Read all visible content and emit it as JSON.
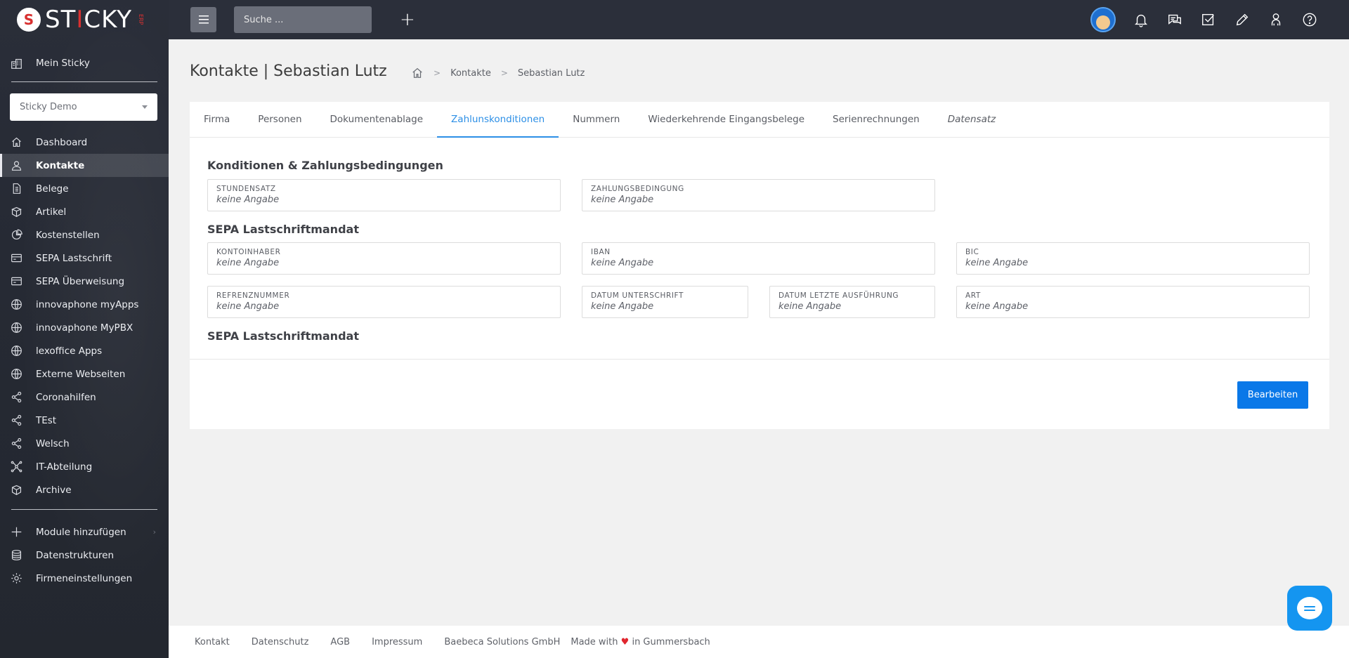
{
  "brand": {
    "name_pre": "ST",
    "name_i": "I",
    "name_post": "CKY",
    "tag": "ERP"
  },
  "sidebar": {
    "top_item": {
      "label": "Mein Sticky",
      "icon": "building-icon"
    },
    "workspace_select": {
      "value": "Sticky Demo"
    },
    "nav": [
      {
        "label": "Dashboard",
        "icon": "home-icon",
        "active": false
      },
      {
        "label": "Kontakte",
        "icon": "contacts-icon",
        "active": true
      },
      {
        "label": "Belege",
        "icon": "document-icon",
        "active": false
      },
      {
        "label": "Artikel",
        "icon": "box-icon",
        "active": false
      },
      {
        "label": "Kostenstellen",
        "icon": "pie-chart-icon",
        "active": false
      },
      {
        "label": "SEPA Lastschrift",
        "icon": "sepa-card-icon",
        "active": false
      },
      {
        "label": "SEPA Überweisung",
        "icon": "sepa-card-icon",
        "active": false
      },
      {
        "label": "innovaphone myApps",
        "icon": "globe-icon",
        "active": false
      },
      {
        "label": "innovaphone MyPBX",
        "icon": "globe-icon",
        "active": false
      },
      {
        "label": "lexoffice Apps",
        "icon": "globe-icon",
        "active": false
      },
      {
        "label": "Externe Webseiten",
        "icon": "globe-icon",
        "active": false
      },
      {
        "label": "Coronahilfen",
        "icon": "share-icon",
        "active": false
      },
      {
        "label": "TEst",
        "icon": "share-icon",
        "active": false
      },
      {
        "label": "Welsch",
        "icon": "share-icon",
        "active": false
      },
      {
        "label": "IT-Abteilung",
        "icon": "network-icon",
        "active": false
      },
      {
        "label": "Archive",
        "icon": "archive-box-icon",
        "active": false
      }
    ],
    "bottom": [
      {
        "label": "Module hinzufügen",
        "icon": "plus-icon"
      },
      {
        "label": "Datenstrukturen",
        "icon": "database-icon"
      },
      {
        "label": "Firmeneinstellungen",
        "icon": "gear-icon"
      }
    ]
  },
  "topbar": {
    "search_placeholder": "Suche ...",
    "icons": [
      "avatar",
      "bell-icon",
      "chat-icon",
      "checkbox-icon",
      "pencil-icon",
      "user-icon",
      "help-icon"
    ]
  },
  "page": {
    "title": "Kontakte | Sebastian Lutz",
    "breadcrumb": [
      "Kontakte",
      "Sebastian Lutz"
    ]
  },
  "tabs": [
    {
      "label": "Firma",
      "active": false,
      "italic": false
    },
    {
      "label": "Personen",
      "active": false,
      "italic": false
    },
    {
      "label": "Dokumentenablage",
      "active": false,
      "italic": false
    },
    {
      "label": "Zahlunskonditionen",
      "active": true,
      "italic": false
    },
    {
      "label": "Nummern",
      "active": false,
      "italic": false
    },
    {
      "label": "Wiederkehrende Eingangsbelege",
      "active": false,
      "italic": false
    },
    {
      "label": "Serienrechnungen",
      "active": false,
      "italic": false
    },
    {
      "label": "Datensatz",
      "active": false,
      "italic": true
    }
  ],
  "sections": {
    "konditionen_title": "Konditionen & Zahlungsbedingungen",
    "sepa_title": "SEPA Lastschriftmandat",
    "sepa_title_2": "SEPA Lastschriftmandat"
  },
  "fields": {
    "stundensatz": {
      "label": "STUNDENSATZ",
      "value": "keine Angabe"
    },
    "zahlungsbedingung": {
      "label": "ZAHLUNGSBEDINGUNG",
      "value": "keine Angabe"
    },
    "kontoinhaber": {
      "label": "KONTOINHABER",
      "value": "keine Angabe"
    },
    "iban": {
      "label": "IBAN",
      "value": "keine Angabe"
    },
    "bic": {
      "label": "BIC",
      "value": "keine Angabe"
    },
    "referenznummer": {
      "label": "REFRENZNUMMER",
      "value": "keine Angabe"
    },
    "datum_unterschrift": {
      "label": "DATUM UNTERSCHRIFT",
      "value": "keine Angabe"
    },
    "datum_letzte": {
      "label": "DATUM LETZTE AUSFÜHRUNG",
      "value": "keine Angabe"
    },
    "art": {
      "label": "ART",
      "value": "keine Angabe"
    }
  },
  "actions": {
    "edit_label": "Bearbeiten"
  },
  "footer": {
    "links": [
      "Kontakt",
      "Datenschutz",
      "AGB",
      "Impressum",
      "Baebeca Solutions GmbH"
    ],
    "made_pre": "Made with",
    "made_post": "in Gummersbach"
  },
  "colors": {
    "accent": "#0a78e8",
    "tab_active": "#2c8fe6",
    "sidebar_bg": "#262a34",
    "topbar_bg": "#2b2f3a",
    "heart": "#e0262e"
  }
}
